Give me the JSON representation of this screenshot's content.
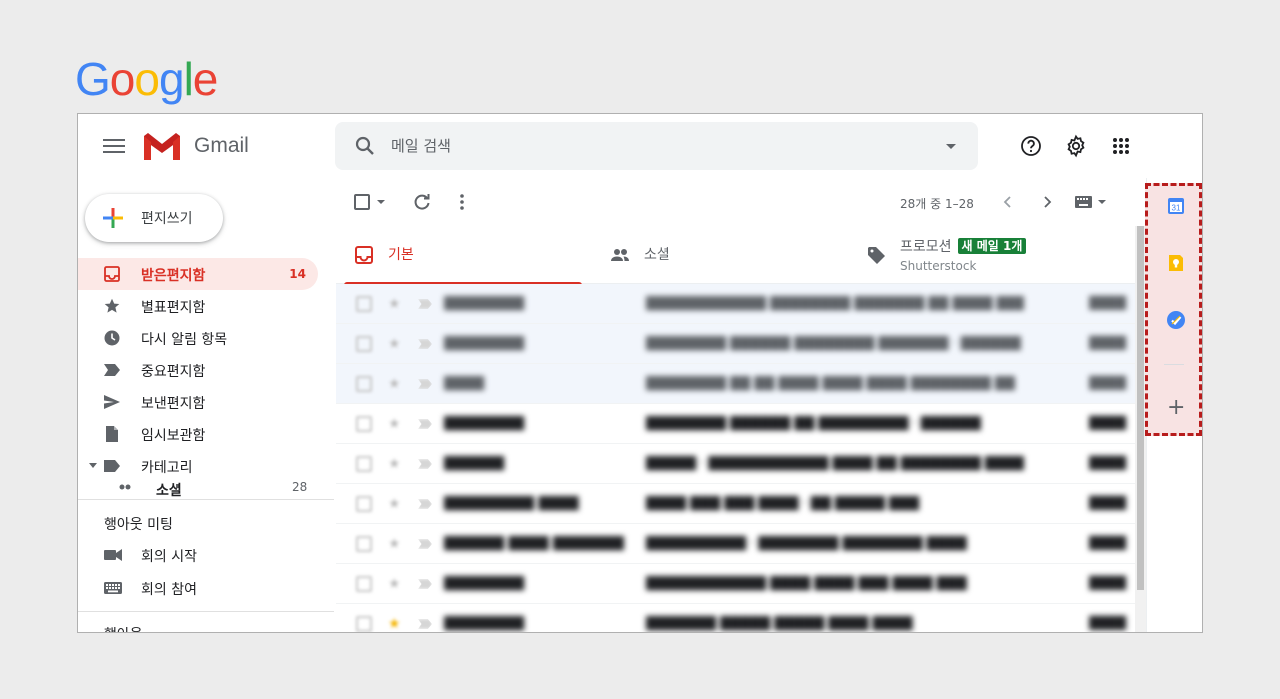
{
  "logo": "Google",
  "app": {
    "name": "Gmail"
  },
  "search": {
    "placeholder": "메일 검색"
  },
  "compose": {
    "label": "편지쓰기"
  },
  "nav": {
    "items": [
      {
        "label": "받은편지함",
        "count": "14",
        "icon": "inbox-icon",
        "active": true
      },
      {
        "label": "별표편지함",
        "icon": "star-icon"
      },
      {
        "label": "다시 알림 항목",
        "icon": "clock-icon"
      },
      {
        "label": "중요편지함",
        "icon": "important-icon"
      },
      {
        "label": "보낸편지함",
        "icon": "send-icon"
      },
      {
        "label": "임시보관함",
        "icon": "draft-icon"
      },
      {
        "label": "카테고리",
        "icon": "label-icon"
      }
    ],
    "sub_item": {
      "label": "소셜",
      "count": "28"
    }
  },
  "meet": {
    "title": "행아웃 미팅",
    "start": "회의 시작",
    "join": "회의 참여"
  },
  "hangouts_cut": "행아웃",
  "toolbar": {
    "pager": "28개 중 1–28"
  },
  "tabs": [
    {
      "label": "기본",
      "icon": "inbox-icon",
      "active": true
    },
    {
      "label": "소셜",
      "icon": "people-icon"
    },
    {
      "label": "프로모션",
      "icon": "tag-icon",
      "badge": "새 메일 1개",
      "sub": "Shutterstock"
    }
  ],
  "colors": {
    "accent": "#d93025",
    "badge": "#188038",
    "highlight_border": "#b71c1c",
    "highlight_fill": "#f8e3e3"
  }
}
